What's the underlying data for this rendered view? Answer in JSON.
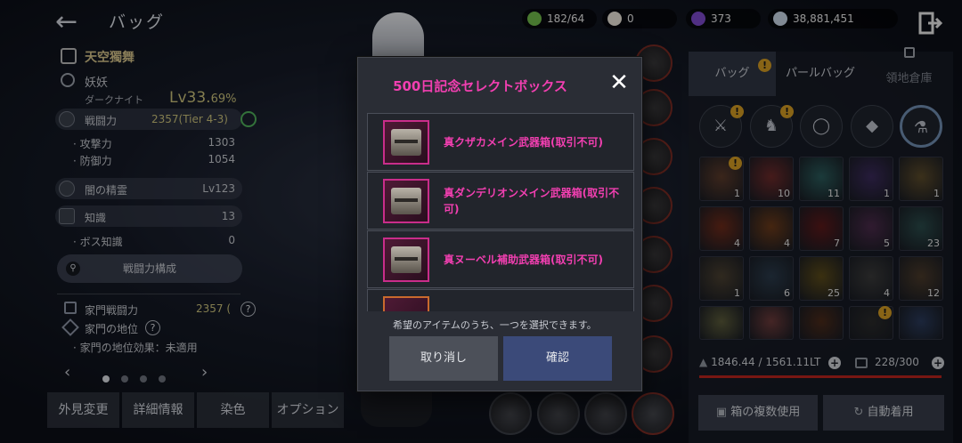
{
  "header": {
    "back_glyph": "←",
    "title": "バッグ",
    "resources": [
      {
        "icon": "energy-icon",
        "color": "#6fb84a",
        "value": "182/64"
      },
      {
        "icon": "pearl-icon",
        "color": "#e8e2d8",
        "value": "0"
      },
      {
        "icon": "purple-orb-icon",
        "color": "#7b49c9",
        "value": "373"
      },
      {
        "icon": "silver-coin-icon",
        "color": "#c7d4e3",
        "value": "38,881,451"
      }
    ]
  },
  "profile": {
    "family_name": "天空獨舞",
    "char_name": "妖妖",
    "class": "ダークナイト",
    "level_main": "Lv33.",
    "level_pct": "69%",
    "combat_power_label": "戦闘力",
    "combat_power_value": "2357(Tier 4-3)",
    "attack_label": "攻撃力",
    "attack_value": "1303",
    "defense_label": "防御力",
    "defense_value": "1054",
    "spirit_label": "闇の精霊",
    "spirit_value": "Lv123",
    "knowledge_label": "知識",
    "knowledge_value": "13",
    "boss_label": "ボス知識",
    "boss_value": "0",
    "combat_build_button": "戦闘力構成",
    "family_combat_label": "家門戦闘力",
    "family_combat_value": "2357 (",
    "family_status_label": "家門の地位",
    "family_status_effect": "家門の地位効果：未適用",
    "prev_glyph": "‹",
    "next_glyph": "›"
  },
  "bottom_tabs": [
    "外見変更",
    "詳細情報",
    "染色",
    "オプション"
  ],
  "bag": {
    "tabs": [
      "バッグ",
      "パールバッグ",
      "領地倉庫"
    ],
    "alert_glyph": "!",
    "weight": "1846.44 / 1561.11LT",
    "slots": "228/300",
    "multi_use_button": "箱の複数使用",
    "auto_equip_button": "自動着用",
    "item_counts": [
      "1",
      "10",
      "11",
      "1",
      "1",
      "4",
      "4",
      "7",
      "5",
      "23",
      "1",
      "6",
      "25",
      "4",
      "12",
      "",
      "",
      "",
      "",
      ""
    ]
  },
  "modal": {
    "title": "500日記念セレクトボックス",
    "close_glyph": "✕",
    "items": [
      "真クザカメイン武器箱(取引不可)",
      "真ダンデリオンメイン武器箱(取引不可)",
      "真ヌーベル補助武器箱(取引不可)"
    ],
    "description": "希望のアイテムのうち、一つを選択できます。",
    "cancel_button": "取り消し",
    "confirm_button": "確認"
  },
  "colors": {
    "accent_pink": "#f23fb1",
    "cancel_button_bg": "#4c5059",
    "confirm_button_bg": "#3b4a79",
    "weight_bar_red": "#b9241c"
  }
}
